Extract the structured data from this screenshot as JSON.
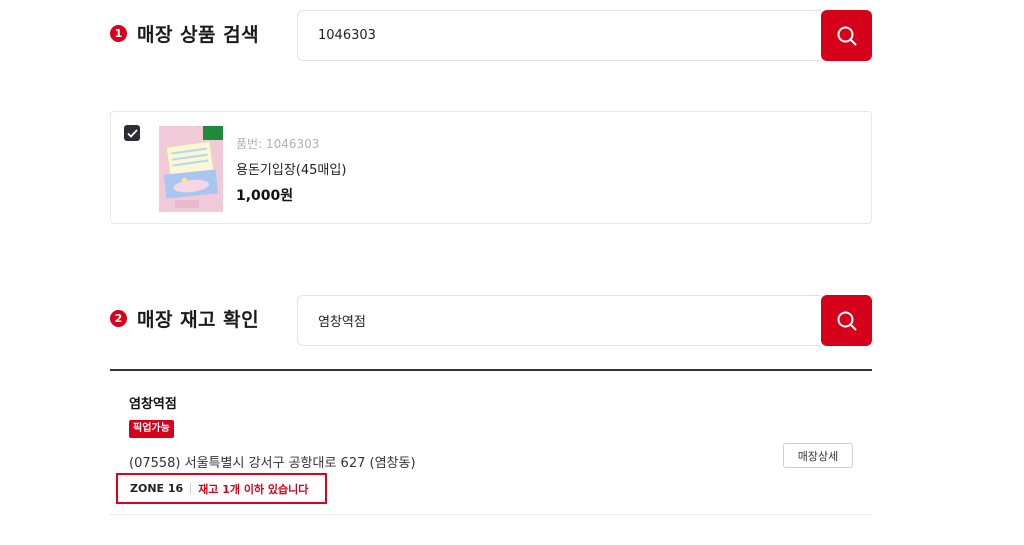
{
  "section1": {
    "number": "1",
    "title": "매장 상품 검색",
    "search_value": "1046303"
  },
  "product": {
    "code_label": "품번: 1046303",
    "name": "용돈기입장(45매입)",
    "price": "1,000원",
    "checked": true
  },
  "section2": {
    "number": "2",
    "title": "매장 재고 확인",
    "search_value": "염창역점"
  },
  "store": {
    "name": "염창역점",
    "badge": "픽업가능",
    "address": "(07558) 서울특별시 강서구 공항대로 627 (염창동)",
    "zone": "ZONE 16",
    "stock_status": "재고 1개 이하 있습니다",
    "detail_button": "매장상세"
  },
  "icons": {
    "search": "search-icon",
    "check": "check-icon"
  },
  "colors": {
    "accent": "#d7001a",
    "checkbox": "#2c2c3a"
  }
}
